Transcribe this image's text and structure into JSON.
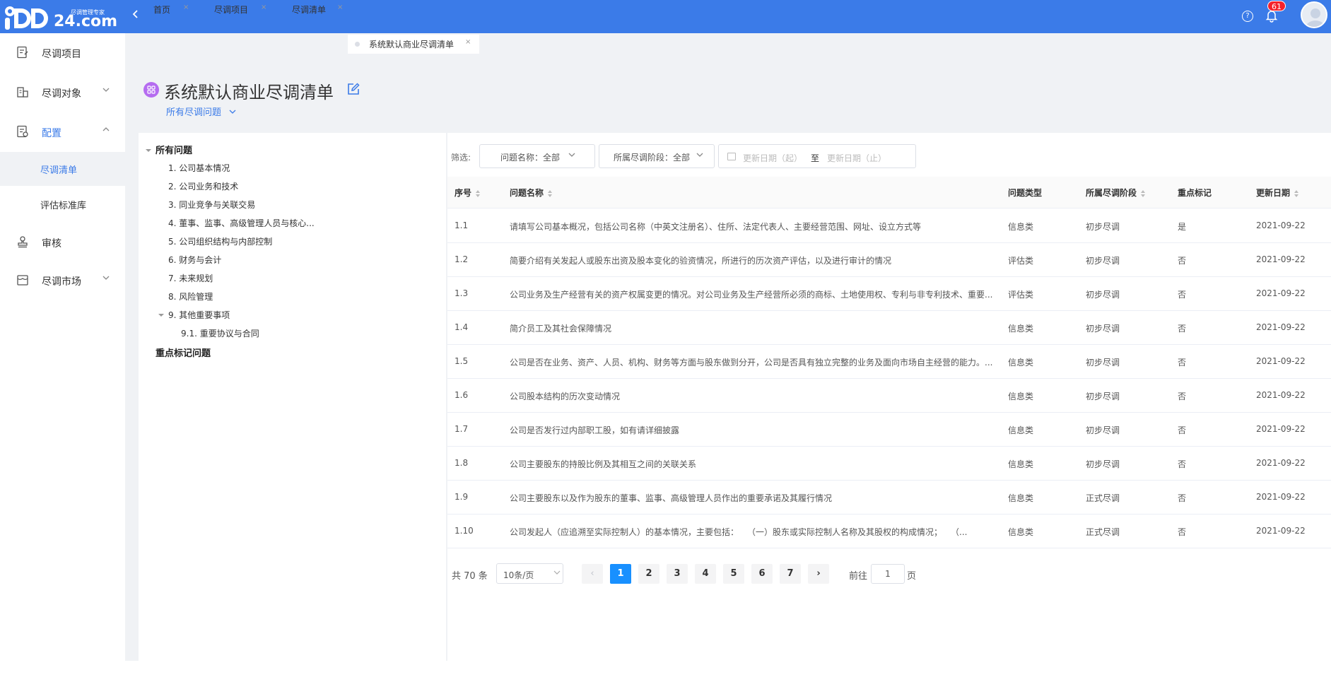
{
  "header": {
    "logo_text": "DD",
    "logo_num": "24.com",
    "logo_slogan": "尽调管理专家",
    "notification_count": "61",
    "help_label": "?"
  },
  "sidebar": {
    "items": [
      {
        "label": "尽调项目",
        "icon": "project-icon"
      },
      {
        "label": "尽调对象",
        "icon": "building-icon",
        "arrow": "chevron-down-icon"
      },
      {
        "label": "配置",
        "icon": "config-icon",
        "arrow": "chevron-up-icon"
      },
      {
        "label": "审核",
        "icon": "stamp-icon"
      },
      {
        "label": "尽调市场",
        "icon": "market-icon",
        "arrow": "chevron-down-icon"
      }
    ],
    "sub_items": [
      {
        "label": "尽调清单"
      },
      {
        "label": "评估标准库"
      }
    ]
  },
  "tabs": [
    {
      "label": "首页"
    },
    {
      "label": "尽调项目"
    },
    {
      "label": "尽调清单"
    },
    {
      "label": "系统默认商业尽调清单"
    }
  ],
  "page": {
    "title": "系统默认商业尽调清单",
    "filter_dropdown": "所有尽调问题"
  },
  "tree": {
    "root": "所有问题",
    "nodes": [
      "1. 公司基本情况",
      "2. 公司业务和技术",
      "3. 同业竞争与关联交易",
      "4. 董事、监事、高级管理人员与核心...",
      "5. 公司组织结构与内部控制",
      "6. 财务与会计",
      "7. 未来规划",
      "8. 风险管理",
      "9. 其他重要事项"
    ],
    "child": "9.1. 重要协议与合同",
    "marked": "重点标记问题"
  },
  "filters": {
    "label": "筛选:",
    "question_name": "问题名称：全部",
    "stage": "所属尽调阶段：全部",
    "date_start_placeholder": "更新日期（起）",
    "date_sep": "至",
    "date_end_placeholder": "更新日期（止）"
  },
  "table": {
    "headers": [
      "序号",
      "问题名称",
      "问题类型",
      "所属尽调阶段",
      "重点标记",
      "更新日期"
    ],
    "rows": [
      [
        "1.1",
        "请填写公司基本概况，包括公司名称（中英文注册名）、住所、法定代表人、主要经营范围、网址、设立方式等",
        "信息类",
        "初步尽调",
        "是",
        "2021-09-22"
      ],
      [
        "1.2",
        "简要介绍有关发起人或股东出资及股本变化的验资情况，所进行的历次资产评估，以及进行审计的情况",
        "评估类",
        "初步尽调",
        "否",
        "2021-09-22"
      ],
      [
        "1.3",
        "公司业务及生产经营有关的资产权属变更的情况。对公司业务及生产经营所必须的商标、土地使用权、专利与非专利技术、重要...",
        "评估类",
        "初步尽调",
        "否",
        "2021-09-22"
      ],
      [
        "1.4",
        "简介员工及其社会保障情况",
        "信息类",
        "初步尽调",
        "否",
        "2021-09-22"
      ],
      [
        "1.5",
        "公司是否在业务、资产、人员、机构、财务等方面与股东做到分开，公司是否具有独立完整的业务及面向市场自主经营的能力。...",
        "信息类",
        "初步尽调",
        "否",
        "2021-09-22"
      ],
      [
        "1.6",
        "公司股本结构的历次变动情况",
        "信息类",
        "初步尽调",
        "否",
        "2021-09-22"
      ],
      [
        "1.7",
        "公司是否发行过内部职工股，如有请详细披露",
        "信息类",
        "初步尽调",
        "否",
        "2021-09-22"
      ],
      [
        "1.8",
        "公司主要股东的持股比例及其相互之间的关联关系",
        "信息类",
        "初步尽调",
        "否",
        "2021-09-22"
      ],
      [
        "1.9",
        "公司主要股东以及作为股东的董事、监事、高级管理人员作出的重要承诺及其履行情况",
        "信息类",
        "正式尽调",
        "否",
        "2021-09-22"
      ],
      [
        "1.10",
        "公司发起人（应追溯至实际控制人）的基本情况，主要包括：　　（一）股东或实际控制人名称及其股权的构成情况；　　（...",
        "信息类",
        "正式尽调",
        "否",
        "2021-09-22"
      ]
    ]
  },
  "pagination": {
    "total": "共 70 条",
    "page_size": "10条/页",
    "pages": [
      "1",
      "2",
      "3",
      "4",
      "5",
      "6",
      "7"
    ],
    "current": "1",
    "prev": "‹",
    "next": "›",
    "goto_label": "前往",
    "goto_value": "1",
    "page_suffix": "页"
  },
  "colors": {
    "primary": "#3b7be8",
    "active_page": "#1890ff",
    "title_icon": "#b56cf0",
    "badge": "#f5222d"
  }
}
